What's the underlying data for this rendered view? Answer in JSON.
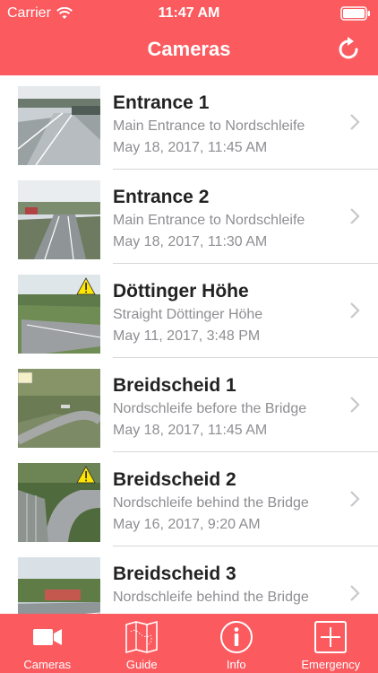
{
  "status": {
    "carrier": "Carrier",
    "time": "11:47 AM"
  },
  "nav": {
    "title": "Cameras"
  },
  "cameras": [
    {
      "name": "Entrance 1",
      "description": "Main Entrance to Nordschleife",
      "date": "May 18, 2017, 11:45 AM",
      "warning": false
    },
    {
      "name": "Entrance 2",
      "description": "Main Entrance to Nordschleife",
      "date": "May 18, 2017, 11:30 AM",
      "warning": false
    },
    {
      "name": "Döttinger Höhe",
      "description": "Straight Döttinger Höhe",
      "date": "May 11, 2017, 3:48 PM",
      "warning": true
    },
    {
      "name": "Breidscheid 1",
      "description": "Nordschleife before the Bridge",
      "date": "May 18, 2017, 11:45 AM",
      "warning": false
    },
    {
      "name": "Breidscheid 2",
      "description": "Nordschleife behind the Bridge",
      "date": "May 16, 2017, 9:20 AM",
      "warning": true
    },
    {
      "name": "Breidscheid 3",
      "description": "Nordschleife behind the Bridge",
      "date": "",
      "warning": false
    }
  ],
  "tabs": [
    {
      "label": "Cameras",
      "icon": "video-camera-icon",
      "active": true
    },
    {
      "label": "Guide",
      "icon": "map-icon",
      "active": false
    },
    {
      "label": "Info",
      "icon": "info-icon",
      "active": false
    },
    {
      "label": "Emergency",
      "icon": "first-aid-cross-icon",
      "active": false
    }
  ],
  "colors": {
    "accent": "#fb5a5f",
    "primary_text": "#222222",
    "secondary_text": "#8e8e93",
    "separator": "#d6d6d6"
  }
}
